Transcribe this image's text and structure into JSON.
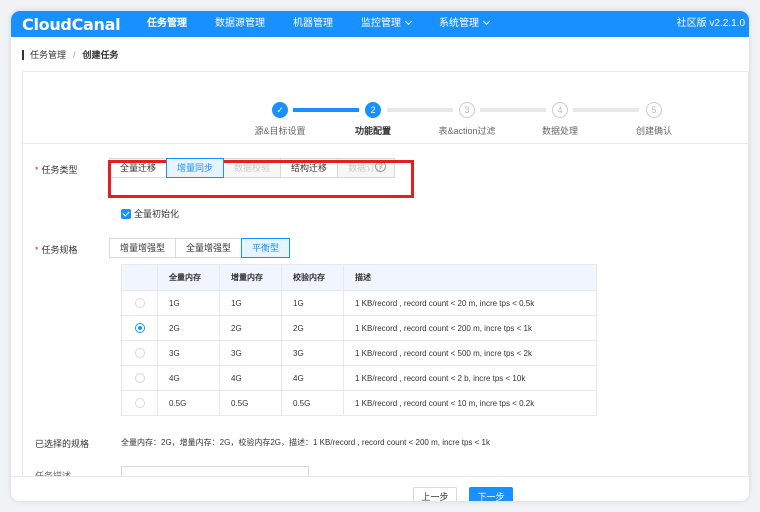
{
  "nav": {
    "logo": "CloudCanal",
    "items": [
      "任务管理",
      "数据源管理",
      "机器管理",
      "监控管理",
      "系统管理"
    ],
    "edition": "社区版 v2.2.1.0"
  },
  "breadcrumb": {
    "parent": "任务管理",
    "sep": "/",
    "current": "创建任务"
  },
  "steps": [
    {
      "num": "✓",
      "label": "源&目标设置"
    },
    {
      "num": "2",
      "label": "功能配置"
    },
    {
      "num": "3",
      "label": "表&action过滤"
    },
    {
      "num": "4",
      "label": "数据处理"
    },
    {
      "num": "5",
      "label": "创建确认"
    }
  ],
  "task_type": {
    "label": "任务类型",
    "options": [
      "全量迁移",
      "增量同步",
      "数据校验",
      "结构迁移",
      "数据订正"
    ],
    "help": "?"
  },
  "full_init": {
    "label": "全量初始化"
  },
  "task_spec": {
    "label": "任务规格",
    "options": [
      "增量增强型",
      "全量增强型",
      "平衡型"
    ]
  },
  "spec_table": {
    "headers": [
      "全量内存",
      "增量内存",
      "校验内存",
      "描述"
    ],
    "rows": [
      [
        "1G",
        "1G",
        "1G",
        "1 KB/record , record count < 20 m, incre tps < 0.5k"
      ],
      [
        "2G",
        "2G",
        "2G",
        "1 KB/record , record count < 200 m, incre tps < 1k"
      ],
      [
        "3G",
        "3G",
        "3G",
        "1 KB/record , record count < 500 m, incre tps < 2k"
      ],
      [
        "4G",
        "4G",
        "4G",
        "1 KB/record , record count < 2 b, incre tps < 10k"
      ],
      [
        "0.5G",
        "0.5G",
        "0.5G",
        "1 KB/record , record count < 10 m, incre tps < 0.2k"
      ]
    ]
  },
  "selected_spec": {
    "label": "已选择的规格",
    "value": "全量内存：2G，增量内存：2G，校验内存2G，描述：1 KB/record , record count < 200 m, incre tps < 1k"
  },
  "task_desc": {
    "label": "任务描述"
  },
  "footer": {
    "prev": "上一步",
    "next": "下一步"
  },
  "colors": {
    "primary": "#1890ff",
    "highlight": "#e41f1f"
  }
}
